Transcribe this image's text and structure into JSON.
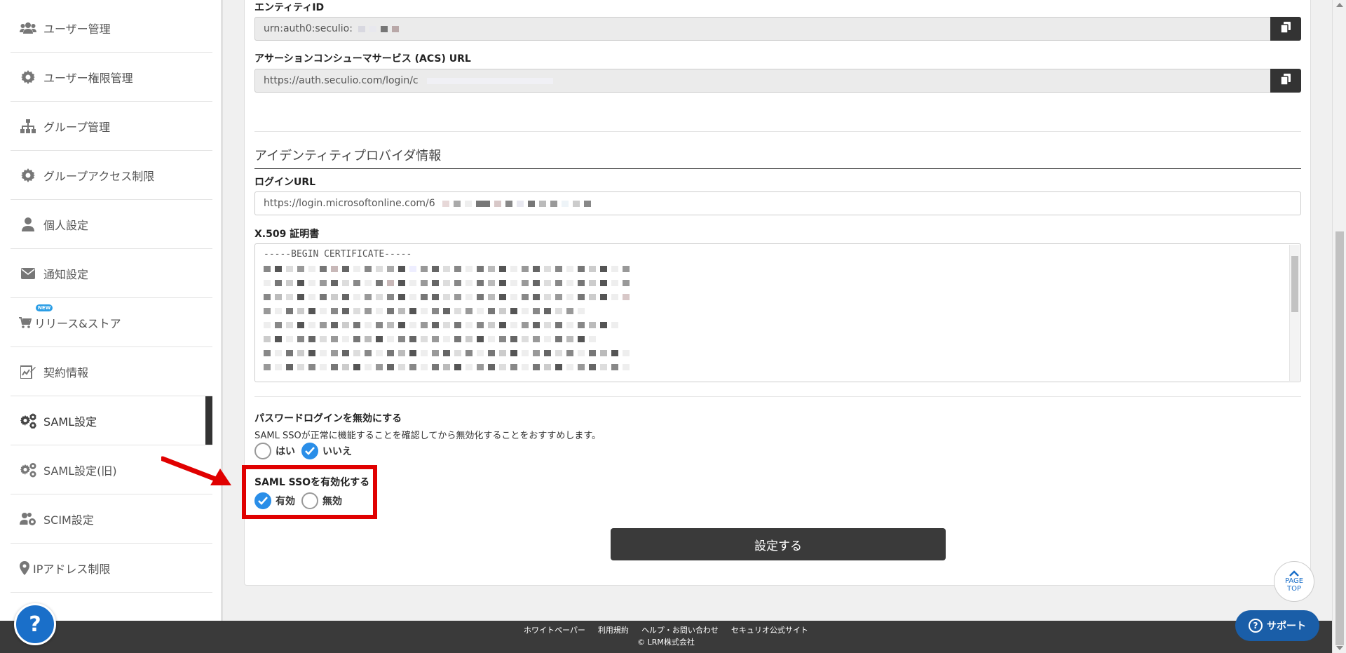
{
  "sidebar": {
    "items": [
      {
        "label": "ユーザー管理",
        "icon": "users-icon"
      },
      {
        "label": "ユーザー権限管理",
        "icon": "gear-icon"
      },
      {
        "label": "グループ管理",
        "icon": "sitemap-icon"
      },
      {
        "label": "グループアクセス制限",
        "icon": "gear-icon"
      },
      {
        "label": "個人設定",
        "icon": "user-icon"
      },
      {
        "label": "通知設定",
        "icon": "envelope-icon"
      },
      {
        "label": "リリース&ストア",
        "icon": "cart-icon",
        "badge": "NEW"
      },
      {
        "label": "契約情報",
        "icon": "contract-icon"
      },
      {
        "label": "SAML設定",
        "icon": "gears-icon",
        "active": true
      },
      {
        "label": "SAML設定(旧)",
        "icon": "gears-icon"
      },
      {
        "label": "SCIM設定",
        "icon": "users-gear-icon"
      },
      {
        "label": "IPアドレス制限",
        "icon": "map-pin-icon"
      }
    ]
  },
  "service_provider": {
    "entity_id_label": "エンティティID",
    "entity_id_value": "urn:auth0:seculio:",
    "acs_url_label": "アサーションコンシューマサービス (ACS) URL",
    "acs_url_value": "https://auth.seculio.com/login/c"
  },
  "identity_provider": {
    "section_title": "アイデンティティプロバイダ情報",
    "login_url_label": "ログインURL",
    "login_url_value": "https://login.microsoftonline.com/6",
    "cert_label": "X.509 証明書",
    "cert_first_line": "-----BEGIN CERTIFICATE-----"
  },
  "password_login": {
    "label": "パスワードログインを無効にする",
    "helper": "SAML SSOが正常に機能することを確認してから無効化することをおすすめします。",
    "options": [
      {
        "label": "はい",
        "selected": false
      },
      {
        "label": "いいえ",
        "selected": true
      }
    ]
  },
  "saml_sso": {
    "label": "SAML SSOを有効化する",
    "options": [
      {
        "label": "有効",
        "selected": true
      },
      {
        "label": "無効",
        "selected": false
      }
    ]
  },
  "submit_label": "設定する",
  "footer": {
    "links": [
      "ホワイトペーパー",
      "利用規約",
      "ヘルプ・お問い合わせ",
      "セキュリオ公式サイト"
    ],
    "copyright": "© LRM株式会社"
  },
  "page_top": {
    "line1": "PAGE",
    "line2": "TOP"
  },
  "support_label": "サポート",
  "colors": {
    "accent": "#2a8ee8",
    "highlight": "#e00000",
    "dark": "#3a3a3a",
    "brand_blue": "#1a6fc9"
  }
}
